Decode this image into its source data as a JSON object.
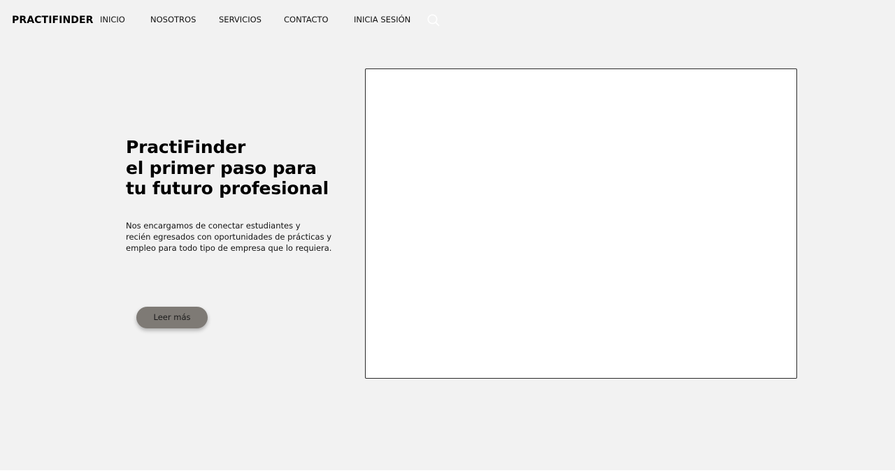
{
  "header": {
    "brand": "PRACTIFINDER",
    "nav": {
      "inicio": "INICIO",
      "nosotros": "NOSOTROS",
      "servicios": "SERVICIOS",
      "contacto": "CONTACTO",
      "sesion": "INICIA SESIÓN"
    },
    "search_icon": "search-icon"
  },
  "hero": {
    "title_lines": [
      "PractiFinder",
      "el primer paso para",
      "tu futuro profesional"
    ],
    "description_lines": [
      "Nos encargamos de conectar estudiantes y",
      "recién egresados con oportunidades de prácticas y",
      "empleo para todo tipo de empresa que lo requiera."
    ],
    "cta_label": "Leer más"
  },
  "colors": {
    "background": "#f2f2f2",
    "button": "#7e7a75",
    "frame_border": "#2b2b2b"
  }
}
